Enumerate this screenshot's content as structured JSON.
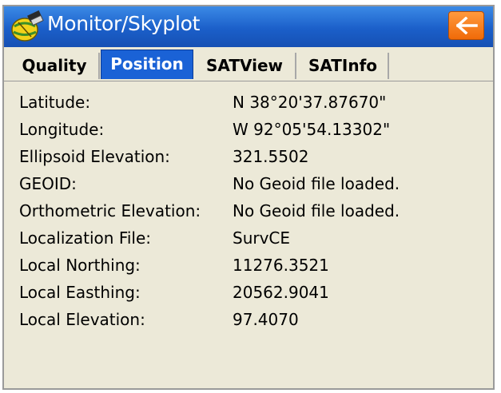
{
  "window": {
    "title": "Monitor/Skyplot"
  },
  "icons": {
    "app": "satellite-globe-icon",
    "back": "back-arrow-icon"
  },
  "colors": {
    "titlebar": "#1b5fc9",
    "active_tab": "#1a62d6",
    "back_button": "#f57a14",
    "panel": "#ece9d8"
  },
  "tabs": [
    {
      "label": "Quality",
      "active": false
    },
    {
      "label": "Position",
      "active": true
    },
    {
      "label": "SATView",
      "active": false
    },
    {
      "label": "SATInfo",
      "active": false
    }
  ],
  "position": {
    "rows": [
      {
        "label": "Latitude:",
        "value": "N 38°20'37.87670\""
      },
      {
        "label": "Longitude:",
        "value": "W 92°05'54.13302\""
      },
      {
        "label": "Ellipsoid Elevation:",
        "value": "321.5502"
      },
      {
        "label": "GEOID:",
        "value": "No Geoid file loaded."
      },
      {
        "label": "Orthometric Elevation:",
        "value": "No Geoid file loaded."
      },
      {
        "label": "Localization File:",
        "value": "SurvCE"
      },
      {
        "label": "Local Northing:",
        "value": "11276.3521"
      },
      {
        "label": "Local Easthing:",
        "value": "20562.9041"
      },
      {
        "label": "Local Elevation:",
        "value": "97.4070"
      }
    ]
  }
}
